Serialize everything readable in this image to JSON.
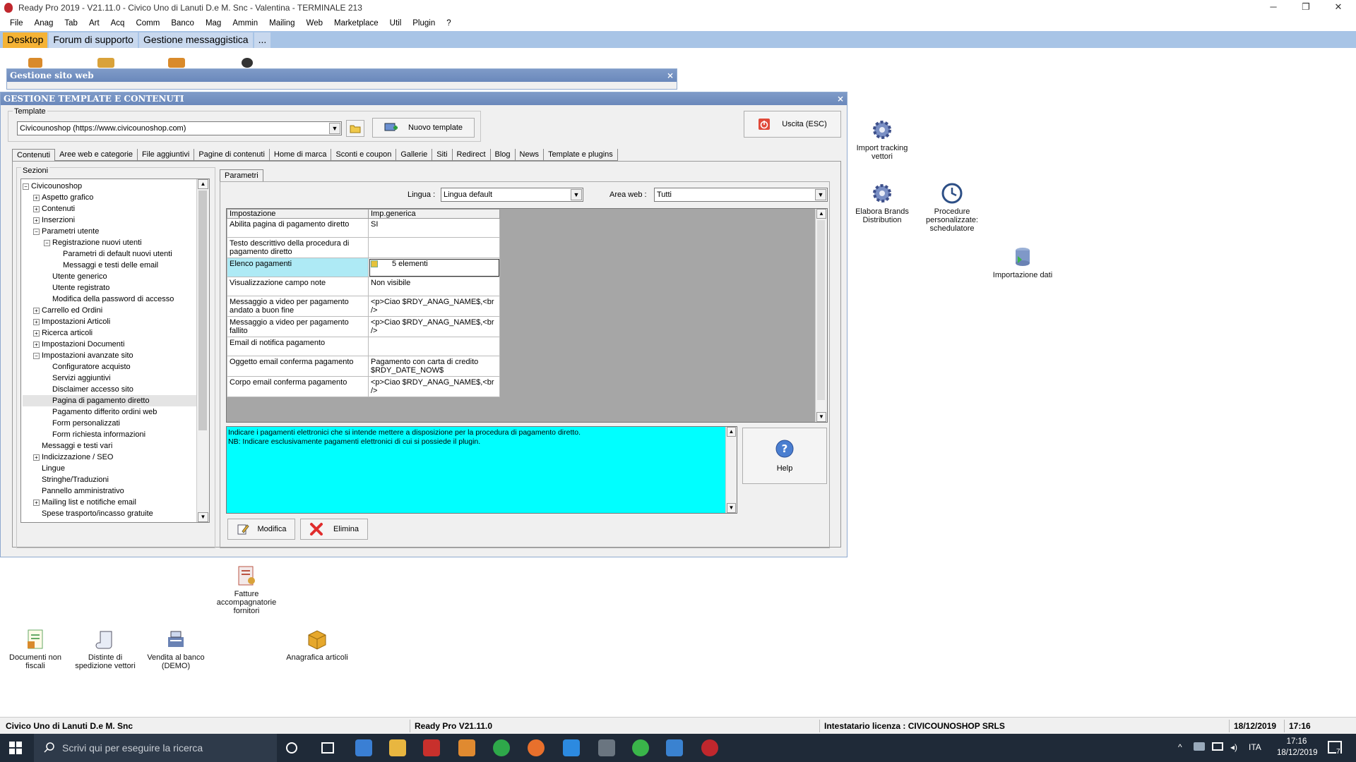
{
  "window": {
    "title": "Ready Pro 2019 - V21.11.0 - Civico Uno di Lanuti D.e M. Snc - Valentina - TERMINALE 213",
    "min_label": "─",
    "max_label": "❐",
    "close_label": "✕"
  },
  "menu": [
    "File",
    "Anag",
    "Tab",
    "Art",
    "Acq",
    "Comm",
    "Banco",
    "Mag",
    "Ammin",
    "Mailing",
    "Web",
    "Marketplace",
    "Util",
    "Plugin",
    "?"
  ],
  "desktop_tabs": [
    "Desktop",
    "Forum di supporto",
    "Gestione messaggistica",
    "..."
  ],
  "desktop_icons": [
    {
      "label": "Import tracking vettori",
      "icon": "gear-icon"
    },
    {
      "label": "Elabora Brands Distribution",
      "icon": "gear-icon"
    },
    {
      "label": "Procedure personalizzate: schedulatore",
      "icon": "clock-icon"
    },
    {
      "label": "Importazione dati",
      "icon": "database-icon"
    },
    {
      "label": "Fatture accompagnatorie fornitori",
      "icon": "invoice-icon"
    },
    {
      "label": "Documenti non fiscali",
      "icon": "document-icon"
    },
    {
      "label": "Distinte di spedizione vettori",
      "icon": "scroll-icon"
    },
    {
      "label": "Vendita al banco (DEMO)",
      "icon": "cash-register-icon"
    },
    {
      "label": "Anagrafica articoli",
      "icon": "box-icon"
    }
  ],
  "bg_window": {
    "title": "Gestione sito web",
    "close": "×"
  },
  "main_window": {
    "title": "GESTIONE TEMPLATE E CONTENUTI",
    "close": "×",
    "template_label": "Template",
    "template_value": "Civicounoshop (https://www.civicounoshop.com)",
    "new_template": "Nuovo template",
    "exit": "Uscita (ESC)",
    "tabs": [
      "Contenuti",
      "Aree web e categorie",
      "File aggiuntivi",
      "Pagine di contenuti",
      "Home di marca",
      "Sconti e coupon",
      "Gallerie",
      "Siti",
      "Redirect",
      "Blog",
      "News",
      "Template e plugins"
    ],
    "sections_label": "Sezioni",
    "tree": [
      {
        "label": "Civicounoshop",
        "level": 0,
        "pm": "−"
      },
      {
        "label": "Aspetto grafico",
        "level": 1,
        "pm": "+"
      },
      {
        "label": "Contenuti",
        "level": 1,
        "pm": "+"
      },
      {
        "label": "Inserzioni",
        "level": 1,
        "pm": "+"
      },
      {
        "label": "Parametri utente",
        "level": 1,
        "pm": "−"
      },
      {
        "label": "Registrazione nuovi utenti",
        "level": 2,
        "pm": "−"
      },
      {
        "label": "Parametri di default nuovi utenti",
        "level": 3,
        "pm": ""
      },
      {
        "label": "Messaggi e testi delle email",
        "level": 3,
        "pm": ""
      },
      {
        "label": "Utente generico",
        "level": 2,
        "pm": ""
      },
      {
        "label": "Utente registrato",
        "level": 2,
        "pm": ""
      },
      {
        "label": "Modifica della password di accesso",
        "level": 2,
        "pm": ""
      },
      {
        "label": "Carrello ed Ordini",
        "level": 1,
        "pm": "+"
      },
      {
        "label": "Impostazioni Articoli",
        "level": 1,
        "pm": "+"
      },
      {
        "label": "Ricerca articoli",
        "level": 1,
        "pm": "+"
      },
      {
        "label": "Impostazioni Documenti",
        "level": 1,
        "pm": "+"
      },
      {
        "label": "Impostazioni avanzate sito",
        "level": 1,
        "pm": "−"
      },
      {
        "label": "Configuratore acquisto",
        "level": 2,
        "pm": ""
      },
      {
        "label": "Servizi aggiuntivi",
        "level": 2,
        "pm": ""
      },
      {
        "label": "Disclaimer accesso sito",
        "level": 2,
        "pm": ""
      },
      {
        "label": "Pagina di pagamento diretto",
        "level": 2,
        "pm": "",
        "selected": true
      },
      {
        "label": "Pagamento differito ordini web",
        "level": 2,
        "pm": ""
      },
      {
        "label": "Form personalizzati",
        "level": 2,
        "pm": ""
      },
      {
        "label": "Form richiesta informazioni",
        "level": 2,
        "pm": ""
      },
      {
        "label": "Messaggi e testi vari",
        "level": 1,
        "pm": ""
      },
      {
        "label": "Indicizzazione / SEO",
        "level": 1,
        "pm": "+"
      },
      {
        "label": "Lingue",
        "level": 1,
        "pm": ""
      },
      {
        "label": "Stringhe/Traduzioni",
        "level": 1,
        "pm": ""
      },
      {
        "label": "Pannello amministrativo",
        "level": 1,
        "pm": ""
      },
      {
        "label": "Mailing list e notifiche email",
        "level": 1,
        "pm": "+"
      },
      {
        "label": "Spese trasporto/incasso gratuite",
        "level": 1,
        "pm": ""
      }
    ],
    "params_tab": "Parametri",
    "lingua_label": "Lingua :",
    "lingua_value": "Lingua default",
    "area_label": "Area web :",
    "area_value": "Tutti",
    "grid_headers": [
      "Impostazione",
      "Imp.generica"
    ],
    "grid_rows": [
      {
        "setting": "Abilita pagina di pagamento diretto",
        "value": "SI"
      },
      {
        "setting": "Testo descrittivo della procedura di pagamento diretto",
        "value": ""
      },
      {
        "setting": "Elenco pagamenti",
        "value": "5 elementi",
        "highlight": true
      },
      {
        "setting": "Visualizzazione campo note",
        "value": "Non visibile"
      },
      {
        "setting": "Messaggio a video per pagamento andato a buon fine",
        "value": "<p>Ciao $RDY_ANAG_NAME$,<br />"
      },
      {
        "setting": "Messaggio a video per pagamento fallito",
        "value": "<p>Ciao $RDY_ANAG_NAME$,<br />"
      },
      {
        "setting": "Email di notifica pagamento",
        "value": ""
      },
      {
        "setting": "Oggetto email conferma pagamento",
        "value": "Pagamento con carta di credito $RDY_DATE_NOW$"
      },
      {
        "setting": "Corpo email conferma pagamento",
        "value": "<p>Ciao $RDY_ANAG_NAME$,<br />"
      }
    ],
    "description_line1": "Indicare i pagamenti elettronici che si intende mettere a disposizione per la procedura di pagamento diretto.",
    "description_line2": "NB: Indicare esclusivamente pagamenti elettronici di cui si possiede il plugin.",
    "help": "Help",
    "modify": "Modifica",
    "delete": "Elimina"
  },
  "statusbar": {
    "company": "Civico Uno di Lanuti D.e M. Snc",
    "version": "Ready Pro V21.11.0",
    "license": "Intestatario licenza : CIVICOUNOSHOP SRLS",
    "date": "18/12/2019",
    "time": "17:16"
  },
  "taskbar": {
    "search_placeholder": "Scrivi qui per eseguire la ricerca",
    "lang": "ITA",
    "clock_time": "17:16",
    "clock_date": "18/12/2019",
    "notif_count": "7"
  },
  "colors": {
    "accent_tab": "#f5b335",
    "tabbar": "#a8c4e6",
    "title_gradient": "#6a88bb",
    "desc_bg": "#00ffff",
    "selected_cell": "#aeeaf5"
  }
}
